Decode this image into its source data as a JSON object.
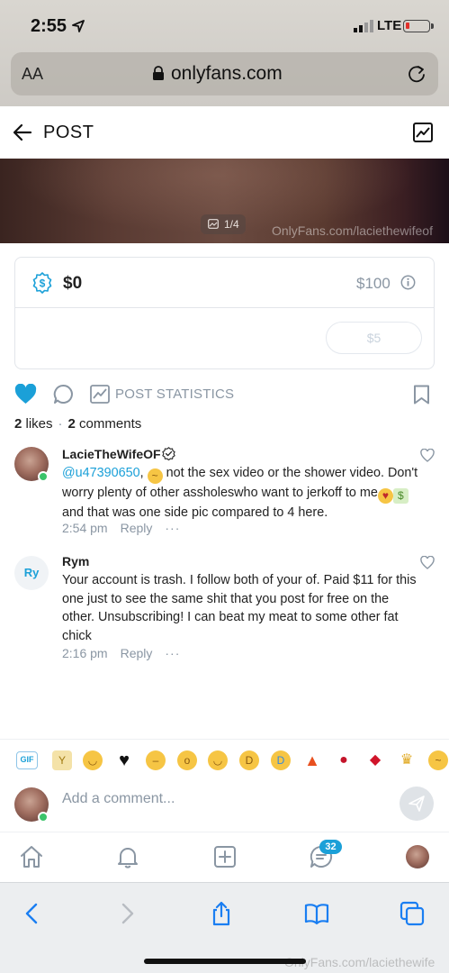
{
  "status_bar": {
    "time": "2:55",
    "network": "LTE"
  },
  "url_bar": {
    "text_size_label": "AA",
    "url": "onlyfans.com"
  },
  "header": {
    "title": "POST"
  },
  "media": {
    "counter": "1/4",
    "watermark": "OnlyFans.com/laciethewifeof"
  },
  "tip": {
    "amount": "$0",
    "max": "$100",
    "button_label": "$5"
  },
  "actions": {
    "stats_label": "POST STATISTICS"
  },
  "counts": {
    "likes_num": "2",
    "likes_word": "likes",
    "comments_num": "2",
    "comments_word": "comments"
  },
  "comments": [
    {
      "author": "LacieTheWifeOF",
      "mention": "@u47390650",
      "text_a": ", ",
      "text_b": " not the sex video or the shower video. Don't worry plenty of other assholeswho want to jerkoff to me",
      "text_c": " and that was one side pic compared to 4 here.",
      "time": "2:54 pm",
      "reply": "Reply",
      "more": "···"
    },
    {
      "author": "Rym",
      "initials": "Ry",
      "text": "Your account is trash. I follow both of your of. Paid $11 for this one just to see the same shit that you post for free on the other. Unsubscribing! I can beat my meat to some other fat chick",
      "time": "2:16 pm",
      "reply": "Reply",
      "more": "···"
    }
  ],
  "emoji_row": {
    "gif_label": "GIF"
  },
  "comment_input": {
    "placeholder": "Add a comment..."
  },
  "bottom_nav": {
    "messages_badge": "32"
  },
  "bottom_watermark": "OnlyFans.com/laciethewife",
  "colors": {
    "accent": "#1ba0d8",
    "muted": "#8a96a3",
    "online": "#3bc46a"
  }
}
